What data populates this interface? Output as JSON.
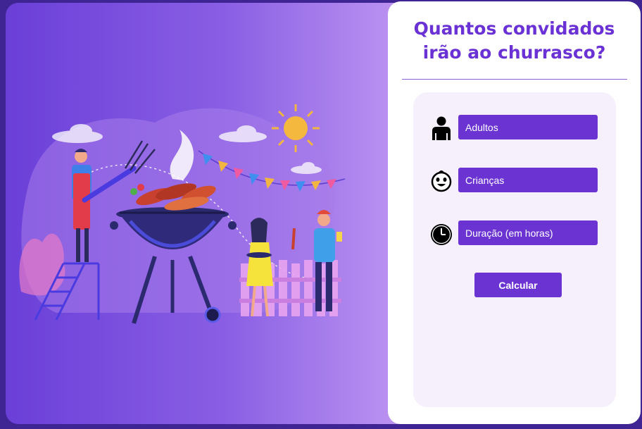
{
  "panel": {
    "title_line1": "Quantos convidados",
    "title_line2": "irão ao churrasco?"
  },
  "form": {
    "fields": [
      {
        "placeholder": "Adultos",
        "icon": "adult-icon"
      },
      {
        "placeholder": "Crianças",
        "icon": "child-icon"
      },
      {
        "placeholder": "Duração (em horas)",
        "icon": "clock-icon"
      }
    ],
    "submit_label": "Calcular"
  },
  "colors": {
    "accent": "#6c33d3",
    "title": "#6a32d4",
    "form_background": "#f6f0fd"
  }
}
